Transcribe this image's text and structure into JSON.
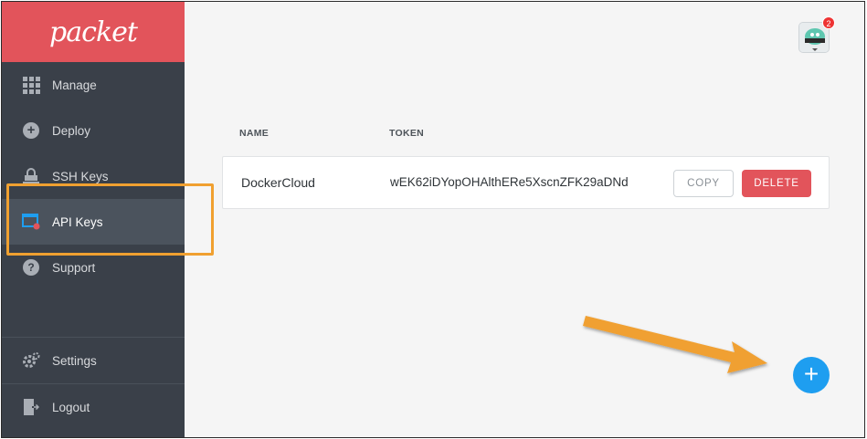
{
  "brand": {
    "name": "packet"
  },
  "sidebar": {
    "items": [
      {
        "label": "Manage",
        "icon": "grid-icon"
      },
      {
        "label": "Deploy",
        "icon": "plus-circle-icon"
      },
      {
        "label": "SSH Keys",
        "icon": "lock-icon"
      },
      {
        "label": "API Keys",
        "icon": "api-key-icon",
        "active": true
      },
      {
        "label": "Support",
        "icon": "question-icon"
      }
    ],
    "bottom_items": [
      {
        "label": "Settings",
        "icon": "gear-icon"
      },
      {
        "label": "Logout",
        "icon": "logout-icon"
      }
    ]
  },
  "header": {
    "notification_count": "2"
  },
  "table": {
    "columns": [
      "NAME",
      "TOKEN"
    ],
    "rows": [
      {
        "name": "DockerCloud",
        "token": "wEK62iDYopOHAlthERe5XscnZFK29aDNd"
      }
    ],
    "copy_label": "COPY",
    "delete_label": "DELETE"
  },
  "fab": {
    "label": "+"
  },
  "colors": {
    "brand": "#e2545b",
    "sidebar": "#3a4049",
    "accent": "#1e9ef0",
    "annotation": "#f0a030"
  }
}
